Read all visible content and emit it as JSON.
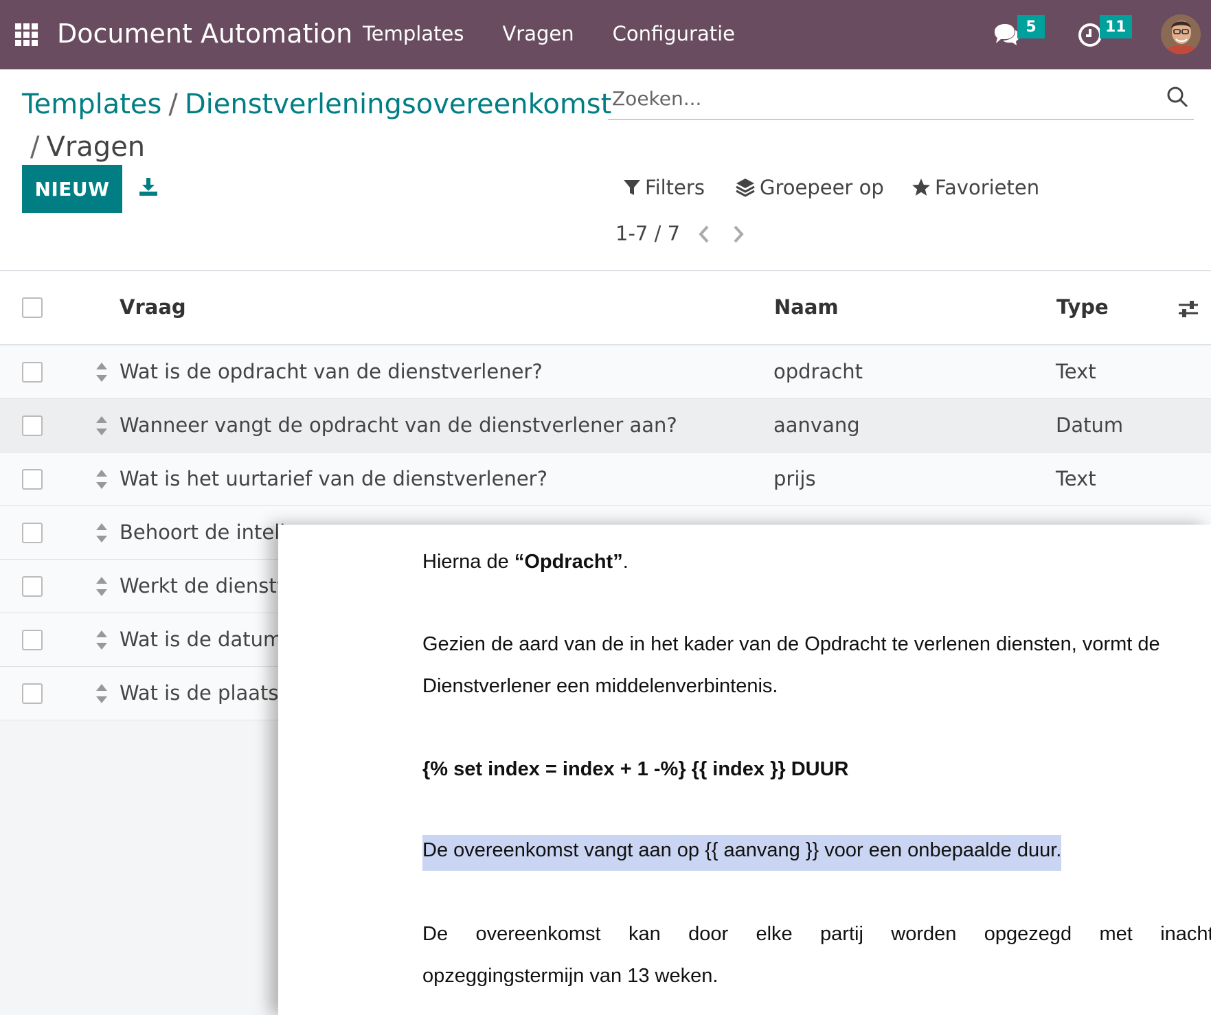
{
  "navbar": {
    "app_title": "Document Automation",
    "menu": [
      "Templates",
      "Vragen",
      "Configuratie"
    ],
    "messages_count": "5",
    "activities_count": "11",
    "brand_color": "#694c5f"
  },
  "breadcrumb": {
    "templates": "Templates",
    "template_name": "Dienstverleningsovereenkomst",
    "current": "Vragen",
    "separator": "/"
  },
  "toolbar": {
    "new_label": "NIEUW",
    "accent_color": "#017e84"
  },
  "search": {
    "placeholder": "Zoeken..."
  },
  "filters": {
    "filters_label": "Filters",
    "group_label": "Groepeer op",
    "favorites_label": "Favorieten"
  },
  "pager": {
    "value": "1-7 / 7"
  },
  "list": {
    "columns": [
      "Vraag",
      "Naam",
      "Type"
    ],
    "rows": [
      {
        "vraag": "Wat is de opdracht van de dienstverlener?",
        "naam": "opdracht",
        "type": "Text"
      },
      {
        "vraag": "Wanneer vangt de opdracht van de dienstverlener aan?",
        "naam": "aanvang",
        "type": "Datum"
      },
      {
        "vraag": "Wat is het uurtarief van de dienstverlener?",
        "naam": "prijs",
        "type": "Text"
      },
      {
        "vraag": "Behoort de intell",
        "naam": "",
        "type": ""
      },
      {
        "vraag": "Werkt de dienstv",
        "naam": "",
        "type": ""
      },
      {
        "vraag": "Wat is de datum",
        "naam": "",
        "type": ""
      },
      {
        "vraag": "Wat is de plaats v",
        "naam": "",
        "type": ""
      }
    ]
  },
  "document": {
    "line1_prefix": "Hierna de ",
    "line1_bold": "“Opdracht”",
    "line1_suffix": ".",
    "line2": "Gezien de aard van de in het kader van de Opdracht te verlenen diensten, vormt de",
    "line3": "Dienstverlener een middelenverbintenis.",
    "line4": "{% set index = index + 1 -%} {{ index }} DUUR",
    "line5": "De overeenkomst vangt aan op {{ aanvang }} voor een onbepaalde duur.",
    "line6_words": [
      "De",
      "overeenkomst",
      "kan",
      "door",
      "elke",
      "partij",
      "worden",
      "opgezegd",
      "met",
      "inachtnen"
    ],
    "line7": "opzeggingstermijn van 13 weken.",
    "highlight_color": "#c9d5f2"
  }
}
